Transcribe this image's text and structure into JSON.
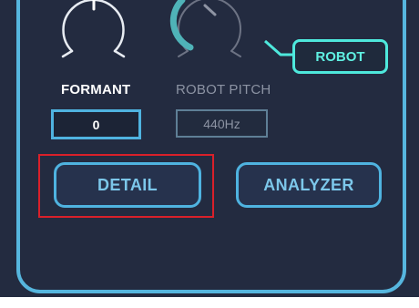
{
  "colors": {
    "panel_bg": "#232b40",
    "accent_blue": "#4fb3e0",
    "accent_cyan": "#4ee8dc",
    "highlight_red": "#d9202a",
    "label_white": "#ffffff",
    "label_muted": "#8c93a3"
  },
  "knobs": {
    "formant_icon": "knob-icon",
    "robot_pitch_icon": "knob-icon"
  },
  "formant": {
    "label": "FORMANT",
    "value": "0"
  },
  "robot_pitch": {
    "label": "ROBOT PITCH",
    "value": "440Hz"
  },
  "mode": {
    "label": "ROBOT"
  },
  "buttons": {
    "detail": "DETAIL",
    "analyzer": "ANALYZER"
  }
}
